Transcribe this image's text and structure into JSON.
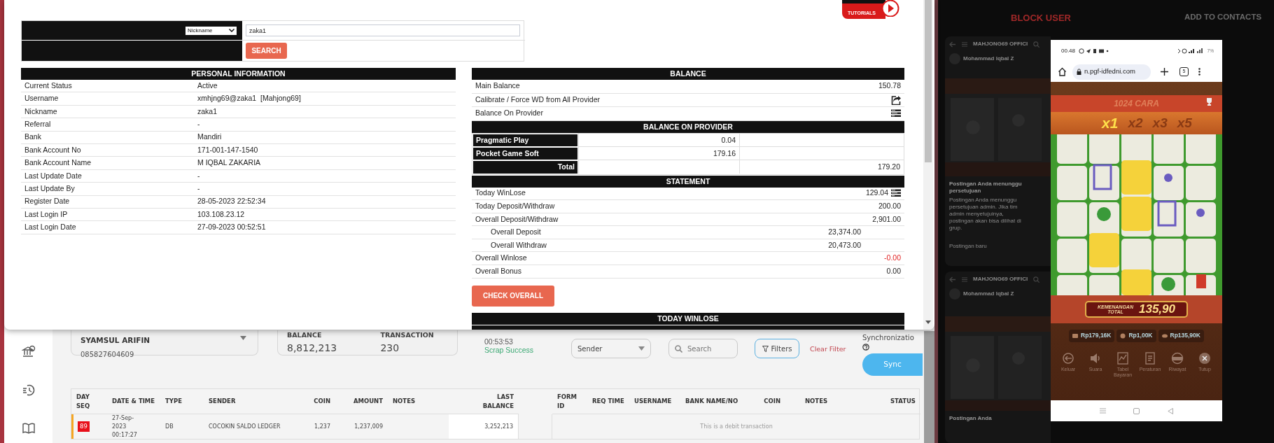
{
  "modal": {
    "video_badge": "TUTORIALS",
    "search": {
      "field": "Nickname",
      "value": "zaka1",
      "button": "SEARCH"
    },
    "personal_information": {
      "title": "PERSONAL INFORMATION",
      "rows": [
        {
          "label": "Current Status",
          "value": "Active"
        },
        {
          "label": "Username",
          "value": "xmhjng69@zaka1  [Mahjong69]"
        },
        {
          "label": "Nickname",
          "value": "zaka1"
        },
        {
          "label": "Referral",
          "value": "-"
        },
        {
          "label": "Bank",
          "value": "Mandiri"
        },
        {
          "label": "Bank Account No",
          "value": "171-001-147-1540"
        },
        {
          "label": "Bank Account Name",
          "value": "M IQBAL ZAKARIA"
        },
        {
          "label": "Last Update Date",
          "value": "-"
        },
        {
          "label": "Last Update By",
          "value": "-"
        },
        {
          "label": "Register Date",
          "value": "28-05-2023 22:52:34"
        },
        {
          "label": "Last Login IP",
          "value": "103.108.23.12"
        },
        {
          "label": "Last Login Date",
          "value": "27-09-2023 00:52:51"
        }
      ]
    },
    "balance": {
      "title": "BALANCE",
      "rows": [
        {
          "kind": "value",
          "label": "Main Balance",
          "value": "150.78"
        },
        {
          "kind": "action",
          "label": "Calibrate / Force WD from All Provider"
        },
        {
          "kind": "list",
          "label": "Balance On Provider"
        }
      ]
    },
    "balance_on_provider": {
      "title": "BALANCE ON PROVIDER",
      "rows": [
        {
          "provider": "Pragmatic Play",
          "balance": "0.04"
        },
        {
          "provider": "Pocket Game Soft",
          "balance": "179.16"
        }
      ],
      "total_label": "Total",
      "total": "179.20"
    },
    "statement": {
      "title": "STATEMENT",
      "rows": [
        {
          "kind": "list",
          "label": "Today WinLose",
          "value": "129.04",
          "negative": false
        },
        {
          "kind": "value",
          "label": "Today Deposit/Withdraw",
          "value": "200.00",
          "negative": false
        },
        {
          "kind": "value",
          "label": "Overall Deposit/Withdraw",
          "value": "2,901.00",
          "negative": false
        },
        {
          "kind": "sub",
          "label": "Overall Deposit",
          "value": "23,374.00",
          "negative": false
        },
        {
          "kind": "sub",
          "label": "Overall Withdraw",
          "value": "20,473.00",
          "negative": false
        },
        {
          "kind": "value",
          "label": "Overall Winlose",
          "value": "-0.00",
          "negative": true
        },
        {
          "kind": "value",
          "label": "Overall Bonus",
          "value": "0.00",
          "negative": false
        }
      ]
    },
    "check_button": "CHECK OVERALL",
    "today_winlose": {
      "title": "TODAY WINLOSE"
    }
  },
  "dashboard": {
    "customer": {
      "name": "SYAMSUL ARIFIN",
      "phone": "085827604609"
    },
    "stats": [
      {
        "label": "BALANCE",
        "value": "8,812,213"
      },
      {
        "label": "TRANSACTION",
        "value": "230"
      }
    ],
    "scrap": {
      "time": "00:53:53",
      "status": "Scrap Success"
    },
    "search_by": "Sender",
    "search_placeholder": "Search",
    "filters_button": "Filters",
    "clear_filter": "Clear Filter",
    "sync_label": "Synchronizatio",
    "sync_button": "Sync",
    "table": {
      "columns": [
        "DAY SEQ",
        "DATE & TIME",
        "TYPE",
        "SENDER",
        "COIN",
        "AMOUNT",
        "NOTES",
        "LAST BALANCE",
        "FORM ID",
        "REQ TIME",
        "USERNAME",
        "BANK NAME/NO",
        "COIN",
        "NOTES",
        "STATUS"
      ],
      "rows": [
        {
          "day_seq": "89",
          "date_time": "27-Sep-2023 00:17:27",
          "type": "DB",
          "sender": "COCOKIN SALDO LEDGER",
          "coin": "1,237",
          "amount": "1,237,009",
          "last_balance": "3,252,213",
          "message": "This is a debit transaction"
        }
      ]
    }
  },
  "chat": {
    "block_user": "BLOCK USER",
    "add_contacts": "ADD TO CONTACTS",
    "cards": [
      {
        "group": "MAHJONG69 OFFICI",
        "author": "Mohammad Iqbal Z",
        "notice_title": "Postingan Anda menunggu persetujuan",
        "notice": "Postingan Anda menunggu persetujuan admin. Jika tim admin menyetujuinya, postingan akan bisa dilihat di grup.",
        "footer": "Postingan baru"
      },
      {
        "group": "MAHJONG69 OFFICI",
        "author": "Mohammad Iqbal Z",
        "notice_title": "Postingan Anda"
      }
    ]
  },
  "phone": {
    "time": "00.48",
    "battery": "7%",
    "url": "n.pgf-idfedni.com",
    "tabs": "5",
    "game": {
      "ways": "1024 CARA",
      "multipliers": [
        {
          "label": "x1",
          "selected": true
        },
        {
          "label": "x2",
          "selected": false
        },
        {
          "label": "x3",
          "selected": false
        },
        {
          "label": "x5",
          "selected": false
        }
      ],
      "win_label": "KEMENANGAN TOTAL",
      "win": "135,90",
      "balances": [
        "Rp179,16K",
        "Rp1,00K",
        "Rp135,90K"
      ],
      "menu": [
        {
          "kind": "exit",
          "label": "Keluar"
        },
        {
          "kind": "sound",
          "label": "Suara"
        },
        {
          "kind": "paytable",
          "label": "Tabel Bayaran"
        },
        {
          "kind": "rules",
          "label": "Peraturan"
        },
        {
          "kind": "history",
          "label": "Riwayat"
        },
        {
          "kind": "close",
          "label": "Tutup"
        }
      ]
    }
  }
}
